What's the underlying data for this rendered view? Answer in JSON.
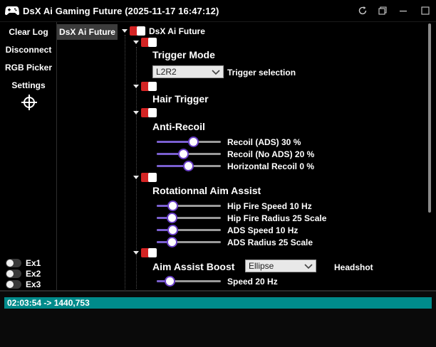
{
  "window": {
    "title": "DsX Ai Gaming Future (2025-11-17 16:47:12)"
  },
  "sidebar": {
    "clear_log": "Clear Log",
    "disconnect": "Disconnect",
    "rgb_picker": "RGB Picker",
    "settings": "Settings",
    "toggles": [
      {
        "label": "Ex1",
        "on": false
      },
      {
        "label": "Ex2",
        "on": false
      },
      {
        "label": "Ex3",
        "on": false
      }
    ]
  },
  "tab": {
    "label": "DsX Ai Future"
  },
  "tree": {
    "root_label": "DsX Ai Future",
    "trigger_mode": {
      "heading": "Trigger Mode",
      "combo_value": "L2R2",
      "combo_label": "Trigger selection"
    },
    "hair_trigger": {
      "heading": "Hair Trigger"
    },
    "anti_recoil": {
      "heading": "Anti-Recoil",
      "sliders": [
        {
          "label": "Recoil (ADS) 30 %",
          "fraction": 0.58
        },
        {
          "label": "Recoil (No ADS) 20 %",
          "fraction": 0.4
        },
        {
          "label": "Horizontal Recoil 0 %",
          "fraction": 0.49
        }
      ]
    },
    "aim_assist": {
      "heading": "Rotationnal Aim Assist",
      "sliders": [
        {
          "label": "Hip Fire Speed 10 Hz",
          "fraction": 0.2
        },
        {
          "label": "Hip Fire Radius 25 Scale",
          "fraction": 0.18
        },
        {
          "label": "ADS Speed 10 Hz",
          "fraction": 0.2
        },
        {
          "label": "ADS Radius 25 Scale",
          "fraction": 0.18
        }
      ]
    },
    "aim_boost": {
      "heading": "Aim Assist Boost",
      "combo_value": "Ellipse",
      "extra_label": "Headshot",
      "sliders": [
        {
          "label": "Speed 20 Hz",
          "fraction": 0.14
        }
      ]
    }
  },
  "log": {
    "lines": [
      "02:03:54 -> 1440,753"
    ]
  },
  "colors": {
    "accent_red": "#d42424",
    "slider_purple": "#6a3fc8",
    "log_teal": "#008b8b"
  }
}
